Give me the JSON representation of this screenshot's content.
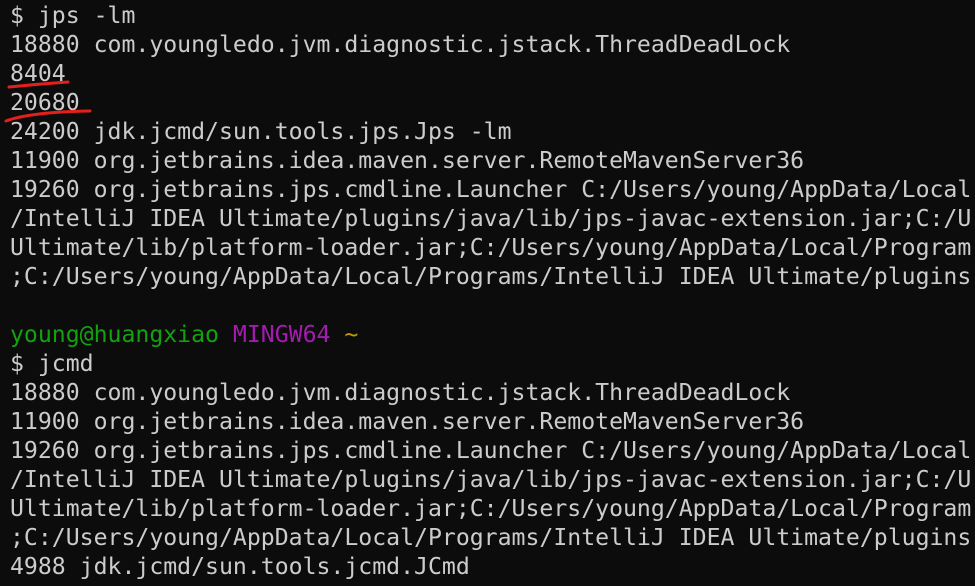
{
  "colors": {
    "background": "#0c0c0c",
    "foreground": "#cccccc",
    "user_host": "#13a10e",
    "system": "#a21caf",
    "cwd": "#c19c00",
    "annotation": "#e3201b"
  },
  "first_session": {
    "command": "$ jps -lm",
    "output": [
      "18880 com.youngledo.jvm.diagnostic.jstack.ThreadDeadLock",
      "8404",
      "20680",
      "24200 jdk.jcmd/sun.tools.jps.Jps -lm",
      "11900 org.jetbrains.idea.maven.server.RemoteMavenServer36",
      "19260 org.jetbrains.jps.cmdline.Launcher C:/Users/young/AppData/Local",
      "/IntelliJ IDEA Ultimate/plugins/java/lib/jps-javac-extension.jar;C:/U",
      "Ultimate/lib/platform-loader.jar;C:/Users/young/AppData/Local/Program",
      ";C:/Users/young/AppData/Local/Programs/IntelliJ IDEA Ultimate/plugins"
    ]
  },
  "prompt": {
    "user_host": "young@huangxiao",
    "system": "MINGW64",
    "cwd": "~"
  },
  "second_session": {
    "command": "$ jcmd",
    "output": [
      "18880 com.youngledo.jvm.diagnostic.jstack.ThreadDeadLock",
      "11900 org.jetbrains.idea.maven.server.RemoteMavenServer36",
      "19260 org.jetbrains.jps.cmdline.Launcher C:/Users/young/AppData/Local",
      "/IntelliJ IDEA Ultimate/plugins/java/lib/jps-javac-extension.jar;C:/U",
      "Ultimate/lib/platform-loader.jar;C:/Users/young/AppData/Local/Program",
      ";C:/Users/young/AppData/Local/Programs/IntelliJ IDEA Ultimate/plugins",
      "4988 jdk.jcmd/sun.tools.jcmd.JCmd"
    ]
  }
}
